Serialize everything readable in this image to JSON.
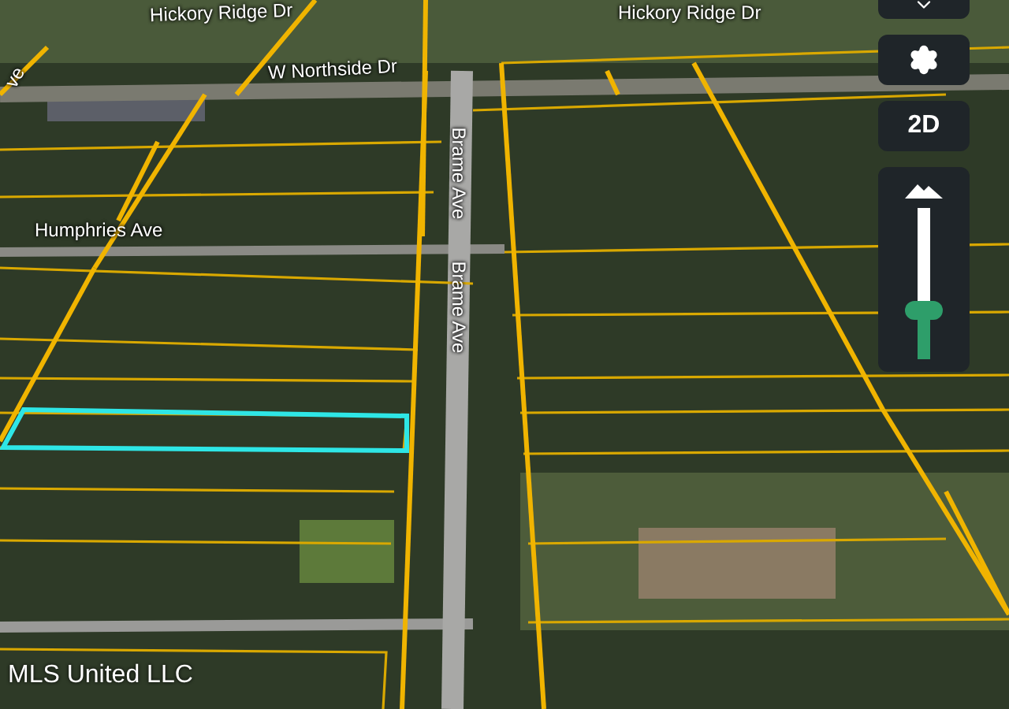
{
  "map": {
    "street_labels": [
      {
        "text": "Hickory Ridge Dr"
      },
      {
        "text": "Hickory Ridge Dr"
      },
      {
        "text": "W Northside Dr"
      },
      {
        "text": "Humphries Ave"
      },
      {
        "text": "Brame Ave"
      },
      {
        "text": "Brame Ave"
      },
      {
        "text": "ve"
      }
    ],
    "attribution": "MLS United LLC"
  },
  "controls": {
    "view_mode": "2D",
    "tilt_slider": {
      "level": 0.3
    }
  }
}
